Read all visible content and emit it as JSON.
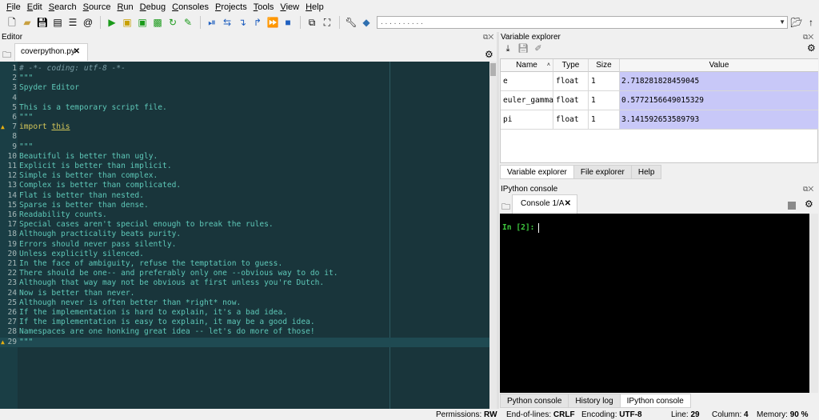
{
  "menu": [
    "File",
    "Edit",
    "Search",
    "Source",
    "Run",
    "Debug",
    "Consoles",
    "Projects",
    "Tools",
    "View",
    "Help"
  ],
  "toolbar": {
    "path_value": ". . . . . . . . . ."
  },
  "editor": {
    "title": "Editor",
    "tab_label": "coverpython.py",
    "tab_close": "✕",
    "lines": [
      {
        "n": "1",
        "text": "# -*- coding: utf-8 -*-",
        "cls": "comment"
      },
      {
        "n": "2",
        "text": "\"\"\"",
        "cls": ""
      },
      {
        "n": "3",
        "text": "Spyder Editor",
        "cls": ""
      },
      {
        "n": "4",
        "text": "",
        "cls": ""
      },
      {
        "n": "5",
        "text": "This is a temporary script file.",
        "cls": ""
      },
      {
        "n": "6",
        "text": "\"\"\"",
        "cls": ""
      },
      {
        "n": "7",
        "text": "import this",
        "cls": "kw"
      },
      {
        "n": "8",
        "text": "",
        "cls": ""
      },
      {
        "n": "9",
        "text": "\"\"\"",
        "cls": ""
      },
      {
        "n": "10",
        "text": "Beautiful is better than ugly.",
        "cls": ""
      },
      {
        "n": "11",
        "text": "Explicit is better than implicit.",
        "cls": ""
      },
      {
        "n": "12",
        "text": "Simple is better than complex.",
        "cls": ""
      },
      {
        "n": "13",
        "text": "Complex is better than complicated.",
        "cls": ""
      },
      {
        "n": "14",
        "text": "Flat is better than nested.",
        "cls": ""
      },
      {
        "n": "15",
        "text": "Sparse is better than dense.",
        "cls": ""
      },
      {
        "n": "16",
        "text": "Readability counts.",
        "cls": ""
      },
      {
        "n": "17",
        "text": "Special cases aren't special enough to break the rules.",
        "cls": ""
      },
      {
        "n": "18",
        "text": "Although practicality beats purity.",
        "cls": ""
      },
      {
        "n": "19",
        "text": "Errors should never pass silently.",
        "cls": ""
      },
      {
        "n": "20",
        "text": "Unless explicitly silenced.",
        "cls": ""
      },
      {
        "n": "21",
        "text": "In the face of ambiguity, refuse the temptation to guess.",
        "cls": ""
      },
      {
        "n": "22",
        "text": "There should be one-- and preferably only one --obvious way to do it.",
        "cls": ""
      },
      {
        "n": "23",
        "text": "Although that way may not be obvious at first unless you're Dutch.",
        "cls": ""
      },
      {
        "n": "24",
        "text": "Now is better than never.",
        "cls": ""
      },
      {
        "n": "25",
        "text": "Although never is often better than *right* now.",
        "cls": ""
      },
      {
        "n": "26",
        "text": "If the implementation is hard to explain, it's a bad idea.",
        "cls": ""
      },
      {
        "n": "27",
        "text": "If the implementation is easy to explain, it may be a good idea.",
        "cls": ""
      },
      {
        "n": "28",
        "text": "Namespaces are one honking great idea -- let's do more of those!",
        "cls": ""
      },
      {
        "n": "29",
        "text": "\"\"\"",
        "cls": ""
      }
    ]
  },
  "variable_explorer": {
    "title": "Variable explorer",
    "columns": [
      "Name",
      "Type",
      "Size",
      "Value"
    ],
    "rows": [
      {
        "name": "e",
        "type": "float",
        "size": "1",
        "value": "2.718281828459045"
      },
      {
        "name": "euler_gamma",
        "type": "float",
        "size": "1",
        "value": "0.5772156649015329"
      },
      {
        "name": "pi",
        "type": "float",
        "size": "1",
        "value": "3.141592653589793"
      }
    ],
    "tabs": [
      "Variable explorer",
      "File explorer",
      "Help"
    ]
  },
  "console": {
    "title": "IPython console",
    "tab_label": "Console 1/A",
    "tab_close": "✕",
    "prompt": "In [2]:",
    "tabs": [
      "Python console",
      "History log",
      "IPython console"
    ]
  },
  "status": {
    "permissions_label": "Permissions:",
    "permissions": "RW",
    "eol_label": "End-of-lines:",
    "eol": "CRLF",
    "encoding_label": "Encoding:",
    "encoding": "UTF-8",
    "line_label": "Line:",
    "line": "29",
    "column_label": "Column:",
    "column": "4",
    "memory_label": "Memory:",
    "memory": "90 %"
  },
  "colors": {
    "editor_bg": "#19353b",
    "code_text": "#5ec8b8",
    "keyword": "#d6c85a",
    "value_highlight": "#c8c8f8",
    "prompt_green": "#3ec83e"
  }
}
